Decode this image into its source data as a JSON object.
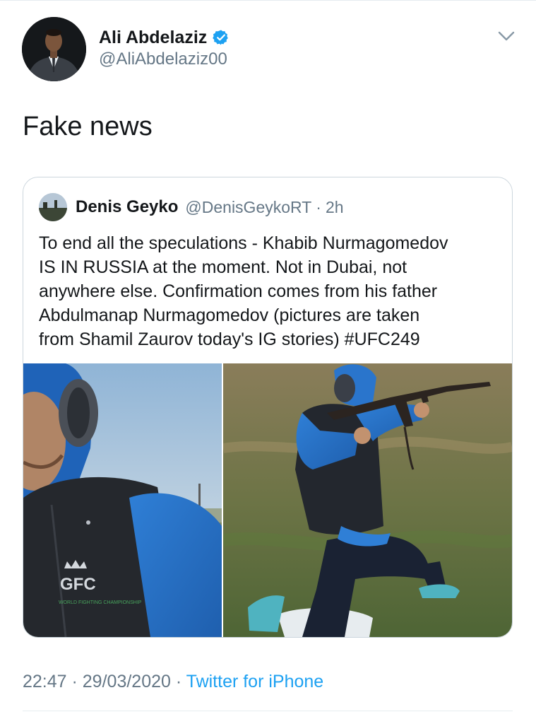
{
  "author": {
    "display_name": "Ali Abdelaziz",
    "handle": "@AliAbdelaziz00",
    "verified": true
  },
  "tweet": {
    "text": "Fake news"
  },
  "quoted": {
    "display_name": "Denis Geyko",
    "handle": "@DenisGeykoRT",
    "separator": "·",
    "time": "2h",
    "text": "To end all the speculations - Khabib Nurmagomedov\nIS IN RUSSIA at the moment. Not in Dubai, not\nanywhere else. Confirmation comes from his father\nAbdulmanap Nurmagomedov (pictures are taken\nfrom Shamil Zaurov today's IG stories) #UFC249",
    "media": {
      "logo_text": "GFC",
      "logo_subtext": "WORLD FIGHTING CHAMPIONSHIP"
    }
  },
  "meta": {
    "time": "22:47",
    "sep1": " · ",
    "date": "29/03/2020",
    "sep2": " · ",
    "source": "Twitter for iPhone"
  },
  "colors": {
    "link": "#1da1f2",
    "secondary_text": "#657786",
    "border": "#ccd6dd",
    "verified": "#1da1f2"
  },
  "icons": {
    "verified": "verified-badge-icon",
    "menu": "chevron-down-icon"
  }
}
